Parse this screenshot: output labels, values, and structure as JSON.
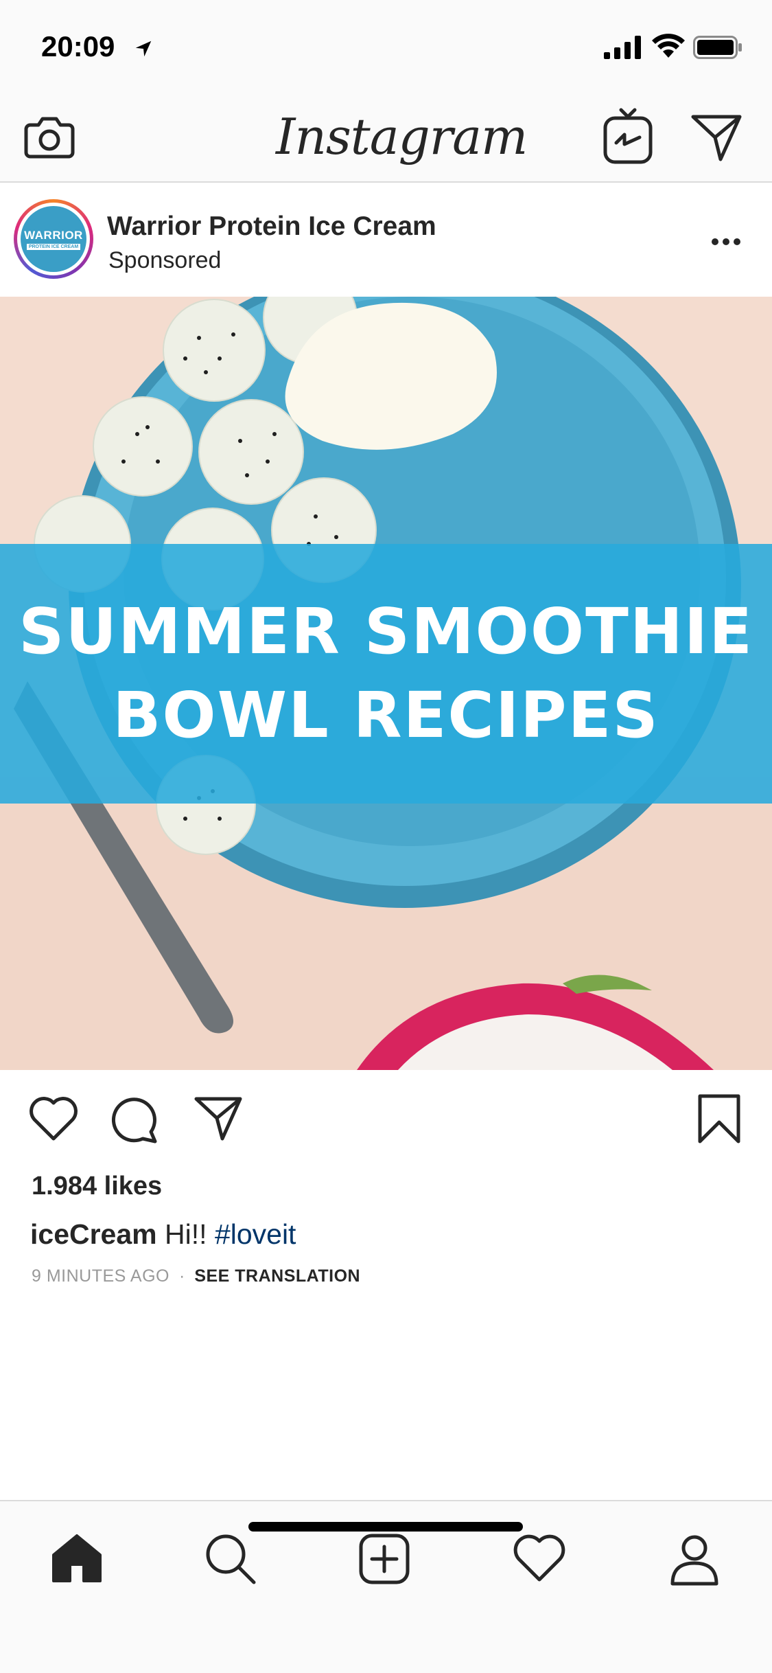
{
  "status_bar": {
    "time": "20:09",
    "icons": [
      "location-arrow-icon",
      "signal-icon",
      "wifi-icon",
      "battery-icon"
    ]
  },
  "top_nav": {
    "logo": "Instagram",
    "left_icon": "camera-icon",
    "right_icons": [
      "igtv-icon",
      "direct-icon"
    ]
  },
  "post": {
    "account": {
      "name": "Warrior Protein Ice Cream",
      "label": "Sponsored",
      "avatar_text": "WARRIOR",
      "avatar_subtext": "PROTEIN ICE CREAM"
    },
    "image": {
      "banner_line_1": "SUMMER SMOOTHIE",
      "banner_line_2": "BOWL RECIPES"
    },
    "actions": [
      "like-icon",
      "comment-icon",
      "share-icon",
      "save-icon"
    ],
    "likes": "1.984 likes",
    "caption": {
      "user": "iceCream",
      "text": "Hi!!",
      "hashtag": "#loveit"
    },
    "time_ago": "9 MINUTES AGO",
    "separator": "·",
    "see_translation": "SEE TRANSLATION"
  },
  "tab_bar": {
    "tabs": [
      "home-icon",
      "search-icon",
      "add-icon",
      "heart-icon",
      "profile-icon"
    ]
  },
  "colors": {
    "accent_link": "#003569",
    "banner": "#28aadc",
    "bowl": "#4aa8cc",
    "muted_text": "#999999"
  }
}
